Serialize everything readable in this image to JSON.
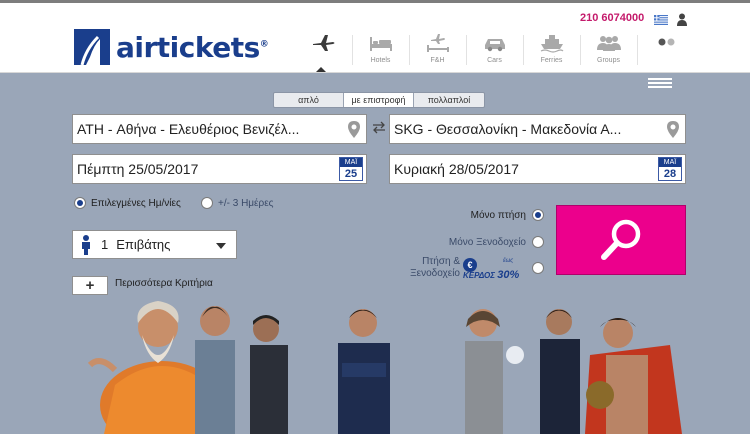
{
  "header": {
    "brand": "airtickets",
    "trademark": "®",
    "phone": "210 6074000",
    "nav": [
      {
        "key": "flights",
        "label": "",
        "icon": "plane-icon",
        "active": true
      },
      {
        "key": "hotels",
        "label": "Hotels",
        "icon": "bed-icon",
        "active": false
      },
      {
        "key": "fh",
        "label": "F&H",
        "icon": "plane-bed-icon",
        "active": false
      },
      {
        "key": "cars",
        "label": "Cars",
        "icon": "car-icon",
        "active": false
      },
      {
        "key": "ferries",
        "label": "Ferries",
        "icon": "ship-icon",
        "active": false
      },
      {
        "key": "groups",
        "label": "Groups",
        "icon": "group-icon",
        "active": false
      },
      {
        "key": "more",
        "label": "",
        "icon": "dots-icon",
        "active": false
      }
    ]
  },
  "trip_type": {
    "tabs": [
      "απλό",
      "με επιστροφή",
      "πολλαπλοί"
    ],
    "selected": "με επιστροφή"
  },
  "search": {
    "from": "ATH - Αθήνα - Ελευθέριος Βενιζέλ...",
    "to": "SKG - Θεσσαλονίκη - Μακεδονία Α...",
    "depart": {
      "text": "Πέμπτη 25/05/2017",
      "cal_month": "ΜΑΪ",
      "cal_day": "25"
    },
    "return": {
      "text": "Κυριακή 28/05/2017",
      "cal_month": "ΜΑΪ",
      "cal_day": "28"
    },
    "date_options": [
      {
        "label": "Επιλεγμένες Ημ/νίες",
        "selected": true
      },
      {
        "label": "+/- 3 Ημέρες",
        "selected": false
      }
    ],
    "passengers": {
      "count": "1",
      "label": "Επιβάτης"
    },
    "more_button": "+",
    "more_label": "Περισσότερα Κριτήρια"
  },
  "products": [
    {
      "label": "Μόνο πτήση",
      "selected": true
    },
    {
      "label": "Μόνο Ξενοδοχείο",
      "selected": false
    },
    {
      "label_line1": "Πτήση &",
      "label_line2": "Ξενοδοχείο",
      "selected": false
    }
  ],
  "promo": {
    "coin": "€",
    "until": "έως",
    "text": "ΚΕΡΔΟΣ",
    "percent": "30%"
  },
  "colors": {
    "brand_blue": "#1a3e8c",
    "accent_pink": "#ec008c",
    "background": "#9aa6b8"
  }
}
